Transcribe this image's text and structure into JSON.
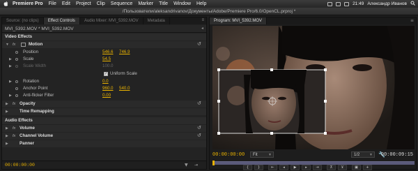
{
  "menubar": {
    "apple": "",
    "app": "Premiere Pro",
    "items": [
      "File",
      "Edit",
      "Project",
      "Clip",
      "Sequence",
      "Marker",
      "Title",
      "Window",
      "Help"
    ],
    "time": "21:49",
    "user": "Александр Иванов"
  },
  "window_title": "/Пользователи/aleksandrivanov/Документы/Adobe/Premiere Pro/6.0/OpenCL.prproj *",
  "left_panel": {
    "tabs": [
      "Source: (no clips)",
      "Effect Controls",
      "Audio Mixer: MVI_5392.MOV",
      "Metadata"
    ],
    "active_tab": 1,
    "tab_menu": "≡",
    "clip_path": "MVI_5392.MOV * MVI_5392.MOV",
    "section_video": "Video Effects",
    "motion": "Motion",
    "position": {
      "label": "Position",
      "x": "546.6",
      "y": "746.9"
    },
    "scale": {
      "label": "Scale",
      "value": "54.5"
    },
    "scale_width": {
      "label": "Scale Width",
      "value": "100.0"
    },
    "uniform_scale": {
      "label": "Uniform Scale",
      "checked": true
    },
    "rotation": {
      "label": "Rotation",
      "value": "0.0"
    },
    "anchor": {
      "label": "Anchor Point",
      "x": "960.0",
      "y": "540.0"
    },
    "antiflicker": {
      "label": "Anti-flicker Filter",
      "value": "0.00"
    },
    "opacity": "Opacity",
    "time_remap": "Time Remapping",
    "section_audio": "Audio Effects",
    "volume": "Volume",
    "channel_volume": "Channel Volume",
    "panner": "Panner",
    "timecode": "00:00:00:00"
  },
  "right_panel": {
    "tab": "Program: MVI_5392.MOV",
    "tab_menu": "≡",
    "timecode_current": "00:00:00:00",
    "fit": "Fit",
    "resolution": "1/2",
    "timecode_duration": "00:00:09:15",
    "playhead_fraction": 0.0
  },
  "colors": {
    "accent": "#e9b200",
    "panel": "#232323"
  }
}
